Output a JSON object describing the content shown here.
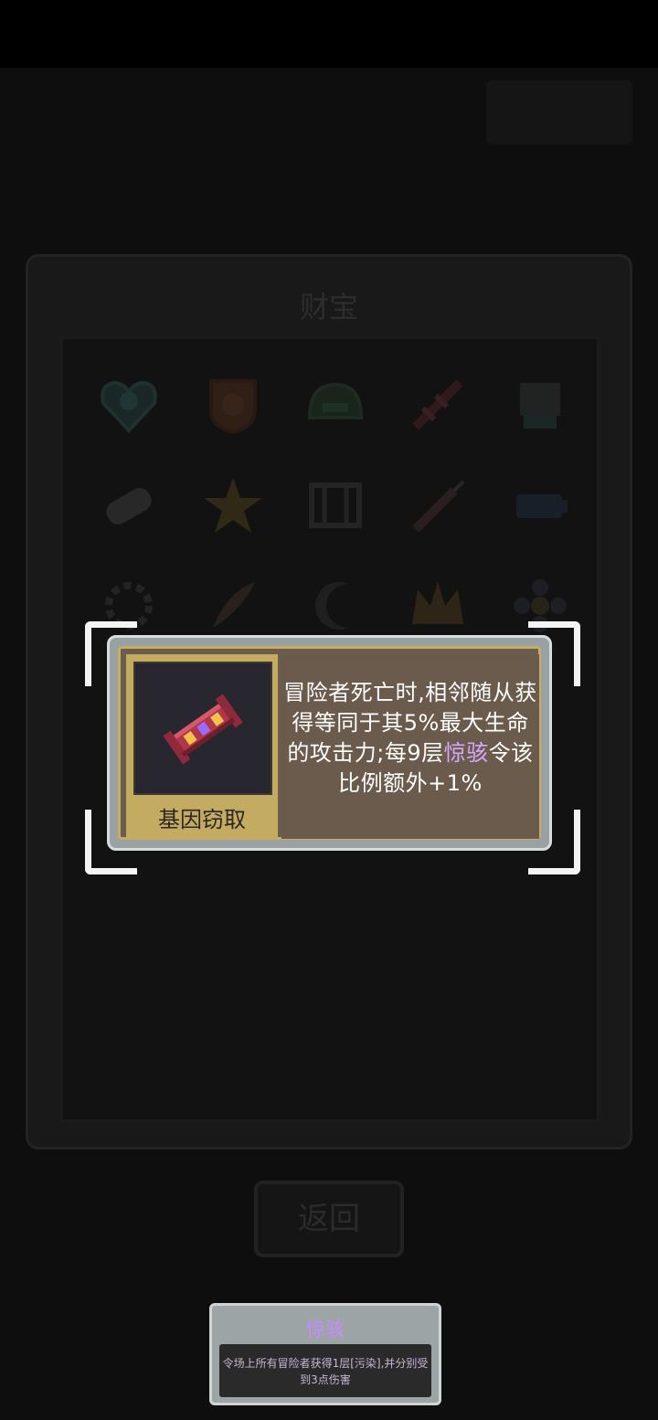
{
  "treasure_window": {
    "title": "财宝"
  },
  "back_button": {
    "label": "返回"
  },
  "tooltip": {
    "item_name": "基因窃取",
    "desc_part1": "冒险者死亡时,相邻随从获得等同于其5%最大生命的攻击力;每9层",
    "desc_highlight": "惊骇",
    "desc_part2": "令该比例额外+1%"
  },
  "status_popup": {
    "title": "惊骇",
    "desc": "令场上所有冒险者获得1层[污染],并分别受到3点伤害"
  },
  "icons": [
    "heart-gem-icon",
    "orange-shield-icon",
    "green-helmet-icon",
    "dna-icon",
    "stone-fist-icon",
    "pill-icon",
    "gold-star-icon",
    "gate-icon",
    "syringe-icon",
    "battery-icon",
    "sun-gear-icon",
    "feather-icon",
    "crescent-icon",
    "gold-crown-icon",
    "flower-icon"
  ],
  "colors": {
    "tooltip_frame": "#9aa1a3",
    "tooltip_gold": "#c7ad62",
    "highlight": "#d7a7ff",
    "status_title": "#c68bff"
  }
}
